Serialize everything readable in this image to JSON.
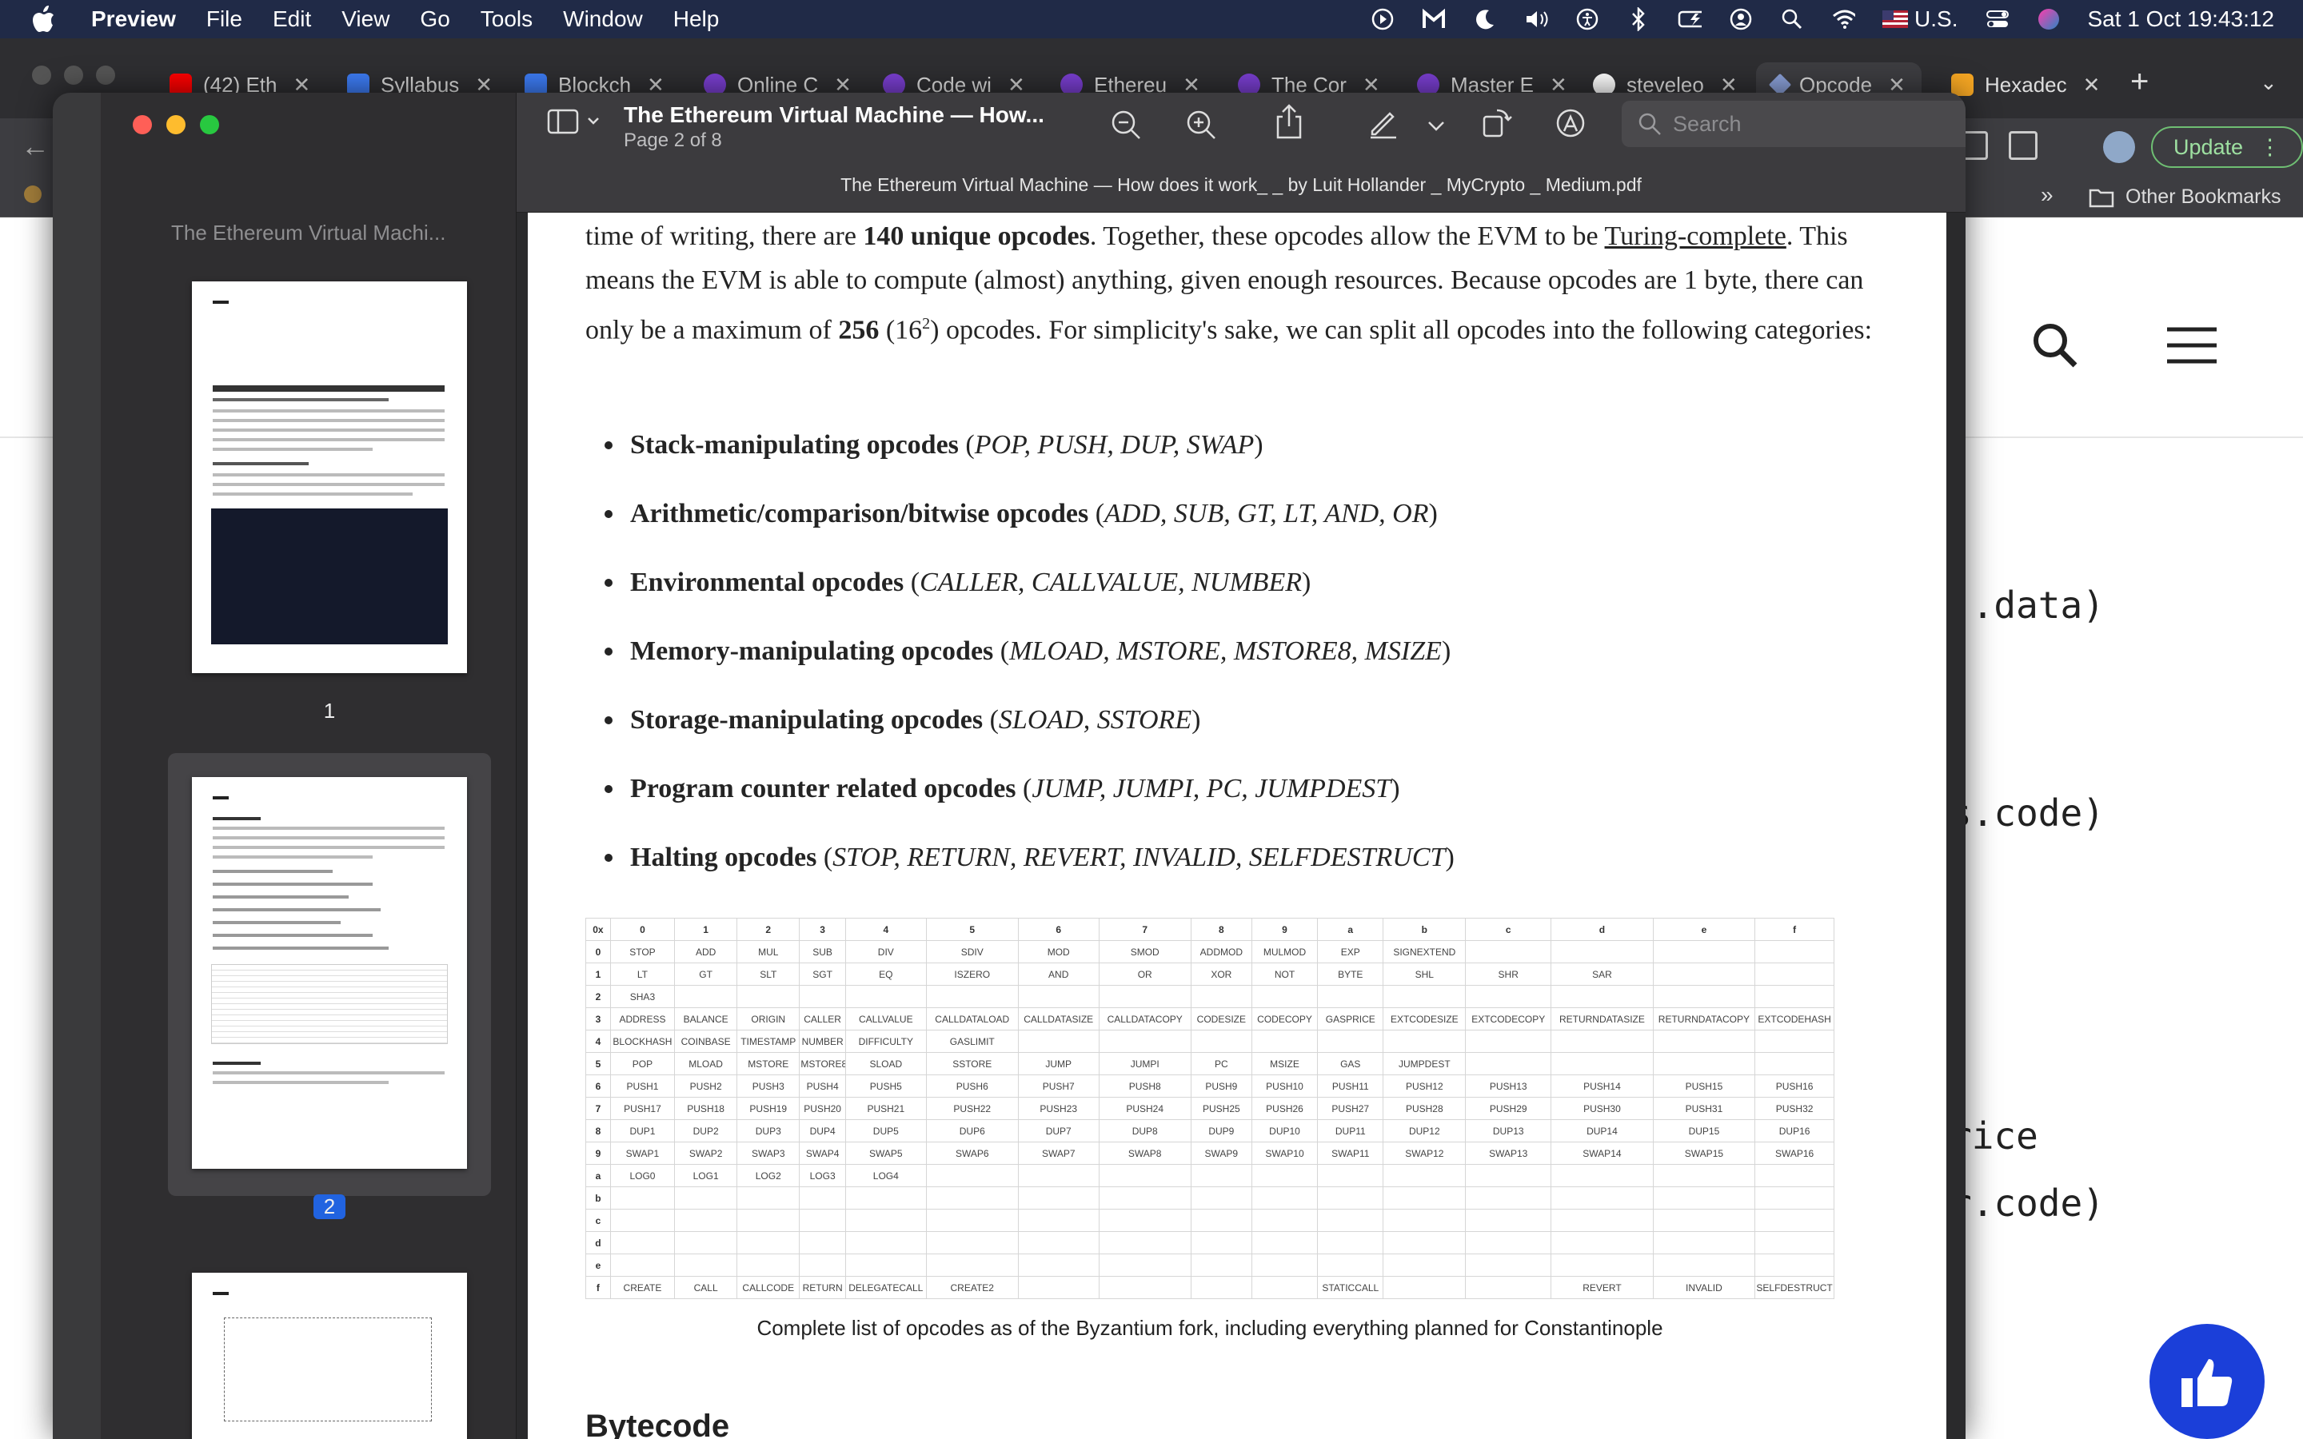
{
  "menubar": {
    "app": "Preview",
    "items": [
      "File",
      "Edit",
      "View",
      "Go",
      "Tools",
      "Window",
      "Help"
    ],
    "input_source": "U.S.",
    "clock": "Sat 1 Oct  19:43:12"
  },
  "browser": {
    "tabs": [
      {
        "label": "(42) Eth",
        "color": "#ff0000"
      },
      {
        "label": "Syllabus",
        "color": "#3d7cf5"
      },
      {
        "label": "Blockch",
        "color": "#3d7cf5"
      },
      {
        "label": "Online C",
        "color": "#7a3fd1"
      },
      {
        "label": "Code wi",
        "color": "#7a3fd1"
      },
      {
        "label": "Ethereu",
        "color": "#7a3fd1"
      },
      {
        "label": "The Cor",
        "color": "#7a3fd1"
      },
      {
        "label": "Master E",
        "color": "#7a3fd1"
      },
      {
        "label": "steveleo",
        "color": "#ffffff"
      },
      {
        "label": "Opcode",
        "color": "#8aa0d8"
      },
      {
        "label": "Hexadec",
        "color": "#f5a623"
      }
    ],
    "update_label": "Update",
    "other_bookmarks": "Other Bookmarks",
    "bg_code": [
      ").data)",
      "s.code)",
      "rice",
      "r.code)"
    ]
  },
  "preview": {
    "doc_title": "The Ethereum Virtual Machine — How...",
    "page_indicator": "Page 2 of 8",
    "search_placeholder": "Search",
    "filename": "The Ethereum Virtual Machine — How does it work_ _ by Luit Hollander _ MyCrypto _ Medium.pdf",
    "sidebar_title": "The Ethereum Virtual Machi...",
    "page_numbers": [
      "1",
      "2"
    ]
  },
  "doc": {
    "para": {
      "p1": "time of writing, there are ",
      "b1": "140 unique opcodes",
      "p2": ". Together, these opcodes allow the EVM to be ",
      "u1": "Turing-complete",
      "p3": ". This means the EVM is able to compute (almost) anything, given enough resources. Because opcodes are 1 byte, there can only be a maximum of ",
      "b2": "256",
      "p4": " (16",
      "sup": "2",
      "p5": ") opcodes. For simplicity's sake, we can split all opcodes into the following categories:"
    },
    "bullets": [
      {
        "bold": "Stack-manipulating opcodes",
        "ops": "POP, PUSH, DUP, SWAP"
      },
      {
        "bold": "Arithmetic/comparison/bitwise opcodes",
        "ops": "ADD, SUB, GT, LT, AND, OR"
      },
      {
        "bold": "Environmental opcodes",
        "ops": "CALLER, CALLVALUE, NUMBER"
      },
      {
        "bold": "Memory-manipulating opcodes",
        "ops": "MLOAD, MSTORE, MSTORE8, MSIZE"
      },
      {
        "bold": "Storage-manipulating opcodes",
        "ops": "SLOAD, SSTORE"
      },
      {
        "bold": "Program counter related opcodes",
        "ops": "JUMP, JUMPI, PC, JUMPDEST"
      },
      {
        "bold": "Halting opcodes",
        "ops": "STOP, RETURN, REVERT, INVALID, SELFDESTRUCT"
      }
    ],
    "table": [
      [
        "0x",
        "0",
        "1",
        "2",
        "3",
        "4",
        "5",
        "6",
        "7",
        "8",
        "9",
        "a",
        "b",
        "c",
        "d",
        "e",
        "f"
      ],
      [
        "0",
        "STOP",
        "ADD",
        "MUL",
        "SUB",
        "DIV",
        "SDIV",
        "MOD",
        "SMOD",
        "ADDMOD",
        "MULMOD",
        "EXP",
        "SIGNEXTEND",
        "",
        "",
        "",
        ""
      ],
      [
        "1",
        "LT",
        "GT",
        "SLT",
        "SGT",
        "EQ",
        "ISZERO",
        "AND",
        "OR",
        "XOR",
        "NOT",
        "BYTE",
        "SHL",
        "SHR",
        "SAR",
        "",
        ""
      ],
      [
        "2",
        "SHA3",
        "",
        "",
        "",
        "",
        "",
        "",
        "",
        "",
        "",
        "",
        "",
        "",
        "",
        "",
        ""
      ],
      [
        "3",
        "ADDRESS",
        "BALANCE",
        "ORIGIN",
        "CALLER",
        "CALLVALUE",
        "CALLDATALOAD",
        "CALLDATASIZE",
        "CALLDATACOPY",
        "CODESIZE",
        "CODECOPY",
        "GASPRICE",
        "EXTCODESIZE",
        "EXTCODECOPY",
        "RETURNDATASIZE",
        "RETURNDATACOPY",
        "EXTCODEHASH"
      ],
      [
        "4",
        "BLOCKHASH",
        "COINBASE",
        "TIMESTAMP",
        "NUMBER",
        "DIFFICULTY",
        "GASLIMIT",
        "",
        "",
        "",
        "",
        "",
        "",
        "",
        "",
        "",
        ""
      ],
      [
        "5",
        "POP",
        "MLOAD",
        "MSTORE",
        "MSTORE8",
        "SLOAD",
        "SSTORE",
        "JUMP",
        "JUMPI",
        "PC",
        "MSIZE",
        "GAS",
        "JUMPDEST",
        "",
        "",
        "",
        ""
      ],
      [
        "6",
        "PUSH1",
        "PUSH2",
        "PUSH3",
        "PUSH4",
        "PUSH5",
        "PUSH6",
        "PUSH7",
        "PUSH8",
        "PUSH9",
        "PUSH10",
        "PUSH11",
        "PUSH12",
        "PUSH13",
        "PUSH14",
        "PUSH15",
        "PUSH16"
      ],
      [
        "7",
        "PUSH17",
        "PUSH18",
        "PUSH19",
        "PUSH20",
        "PUSH21",
        "PUSH22",
        "PUSH23",
        "PUSH24",
        "PUSH25",
        "PUSH26",
        "PUSH27",
        "PUSH28",
        "PUSH29",
        "PUSH30",
        "PUSH31",
        "PUSH32"
      ],
      [
        "8",
        "DUP1",
        "DUP2",
        "DUP3",
        "DUP4",
        "DUP5",
        "DUP6",
        "DUP7",
        "DUP8",
        "DUP9",
        "DUP10",
        "DUP11",
        "DUP12",
        "DUP13",
        "DUP14",
        "DUP15",
        "DUP16"
      ],
      [
        "9",
        "SWAP1",
        "SWAP2",
        "SWAP3",
        "SWAP4",
        "SWAP5",
        "SWAP6",
        "SWAP7",
        "SWAP8",
        "SWAP9",
        "SWAP10",
        "SWAP11",
        "SWAP12",
        "SWAP13",
        "SWAP14",
        "SWAP15",
        "SWAP16"
      ],
      [
        "a",
        "LOG0",
        "LOG1",
        "LOG2",
        "LOG3",
        "LOG4",
        "",
        "",
        "",
        "",
        "",
        "",
        "",
        "",
        "",
        "",
        ""
      ],
      [
        "b",
        "",
        "",
        "",
        "",
        "",
        "",
        "",
        "",
        "",
        "",
        "",
        "",
        "",
        "",
        "",
        ""
      ],
      [
        "c",
        "",
        "",
        "",
        "",
        "",
        "",
        "",
        "",
        "",
        "",
        "",
        "",
        "",
        "",
        "",
        ""
      ],
      [
        "d",
        "",
        "",
        "",
        "",
        "",
        "",
        "",
        "",
        "",
        "",
        "",
        "",
        "",
        "",
        "",
        ""
      ],
      [
        "e",
        "",
        "",
        "",
        "",
        "",
        "",
        "",
        "",
        "",
        "",
        "",
        "",
        "",
        "",
        "",
        ""
      ],
      [
        "f",
        "CREATE",
        "CALL",
        "CALLCODE",
        "RETURN",
        "DELEGATECALL",
        "CREATE2",
        "",
        "",
        "",
        "",
        "STATICCALL",
        "",
        "",
        "REVERT",
        "INVALID",
        "SELFDESTRUCT"
      ]
    ],
    "caption": "Complete list of opcodes as of the Byzantium fork, including everything planned for Constantinople",
    "next_heading": "Bytecode"
  }
}
